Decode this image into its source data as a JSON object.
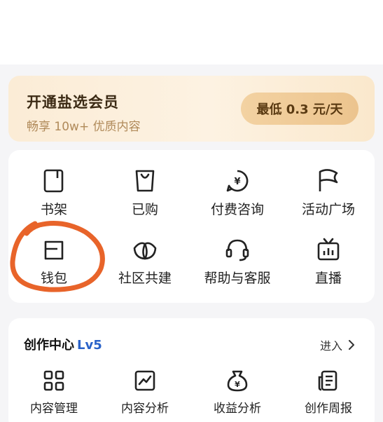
{
  "vip": {
    "title": "开通盐选会员",
    "subtitle": "畅享 10w+ 优质内容",
    "price_button": "最低 0.3 元/天"
  },
  "services": {
    "items": [
      {
        "label": "书架",
        "icon": "bookshelf-icon"
      },
      {
        "label": "已购",
        "icon": "shopping-bag-icon"
      },
      {
        "label": "付费咨询",
        "icon": "paid-consult-icon"
      },
      {
        "label": "活动广场",
        "icon": "flag-icon"
      },
      {
        "label": "钱包",
        "icon": "wallet-icon"
      },
      {
        "label": "社区共建",
        "icon": "leaf-icon"
      },
      {
        "label": "帮助与客服",
        "icon": "headset-icon"
      },
      {
        "label": "直播",
        "icon": "tv-icon"
      }
    ]
  },
  "creation": {
    "title": "创作中心",
    "level": "Lv5",
    "enter_label": "进入",
    "items": [
      {
        "label": "内容管理",
        "icon": "grid-icon"
      },
      {
        "label": "内容分析",
        "icon": "chart-icon"
      },
      {
        "label": "收益分析",
        "icon": "money-bag-icon"
      },
      {
        "label": "创作周报",
        "icon": "report-icon"
      }
    ]
  },
  "colors": {
    "annotation_circle": "#e8642a",
    "level_blue": "#2a63c9",
    "vip_gold": "#ecc48e"
  }
}
